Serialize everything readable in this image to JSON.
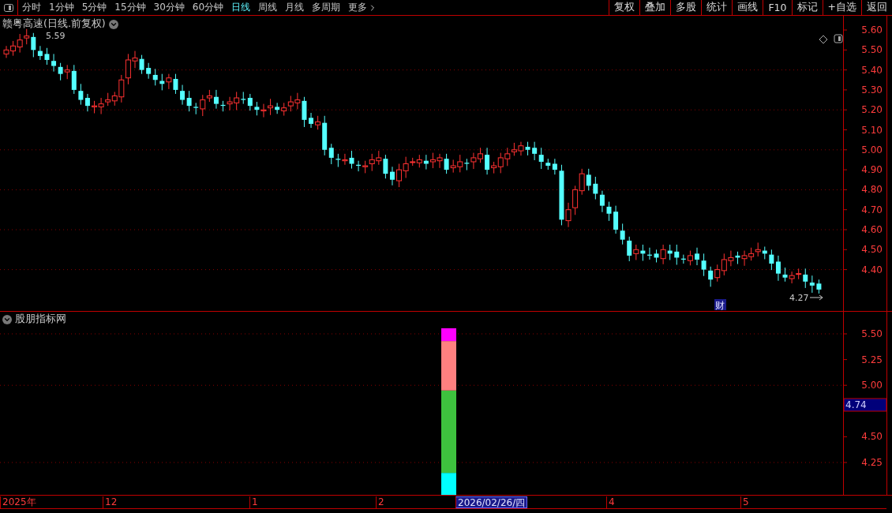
{
  "toolbar": {
    "periods": [
      {
        "label": "分时",
        "selected": false
      },
      {
        "label": "1分钟",
        "selected": false
      },
      {
        "label": "5分钟",
        "selected": false
      },
      {
        "label": "15分钟",
        "selected": false
      },
      {
        "label": "30分钟",
        "selected": false
      },
      {
        "label": "60分钟",
        "selected": false
      },
      {
        "label": "日线",
        "selected": true
      },
      {
        "label": "周线",
        "selected": false
      },
      {
        "label": "月线",
        "selected": false
      },
      {
        "label": "多周期",
        "selected": false
      },
      {
        "label": "更多",
        "selected": false
      }
    ],
    "buttons": [
      "复权",
      "叠加",
      "多股",
      "统计",
      "画线",
      "F10",
      "标记",
      "+自选",
      "返回"
    ]
  },
  "main_chart": {
    "title": "赣粤高速(日线.前复权)",
    "yticks": [
      "5.60",
      "5.50",
      "5.40",
      "5.30",
      "5.20",
      "5.10",
      "5.00",
      "4.90",
      "4.80",
      "4.70",
      "4.60",
      "4.50",
      "4.40"
    ],
    "high_label": "5.59",
    "low_label": "4.27",
    "badge": "财"
  },
  "indicator": {
    "title": "股朋指标网",
    "marker": "4.74",
    "yticks": [
      "5.50",
      "5.25",
      "5.00",
      "4.50",
      "4.25"
    ],
    "bar_segments": [
      {
        "color": "#00ffff"
      },
      {
        "color": "#3ec23e"
      },
      {
        "color": "#ff8080"
      },
      {
        "color": "#ff00ff"
      }
    ]
  },
  "date_axis": {
    "labels": [
      {
        "text": "2025年",
        "selected": false
      },
      {
        "text": "12",
        "selected": false
      },
      {
        "text": "1",
        "selected": false
      },
      {
        "text": "2",
        "selected": false
      },
      {
        "text": "2026/02/26/四",
        "selected": true
      },
      {
        "text": "4",
        "selected": false
      },
      {
        "text": "5",
        "selected": false
      }
    ]
  }
}
